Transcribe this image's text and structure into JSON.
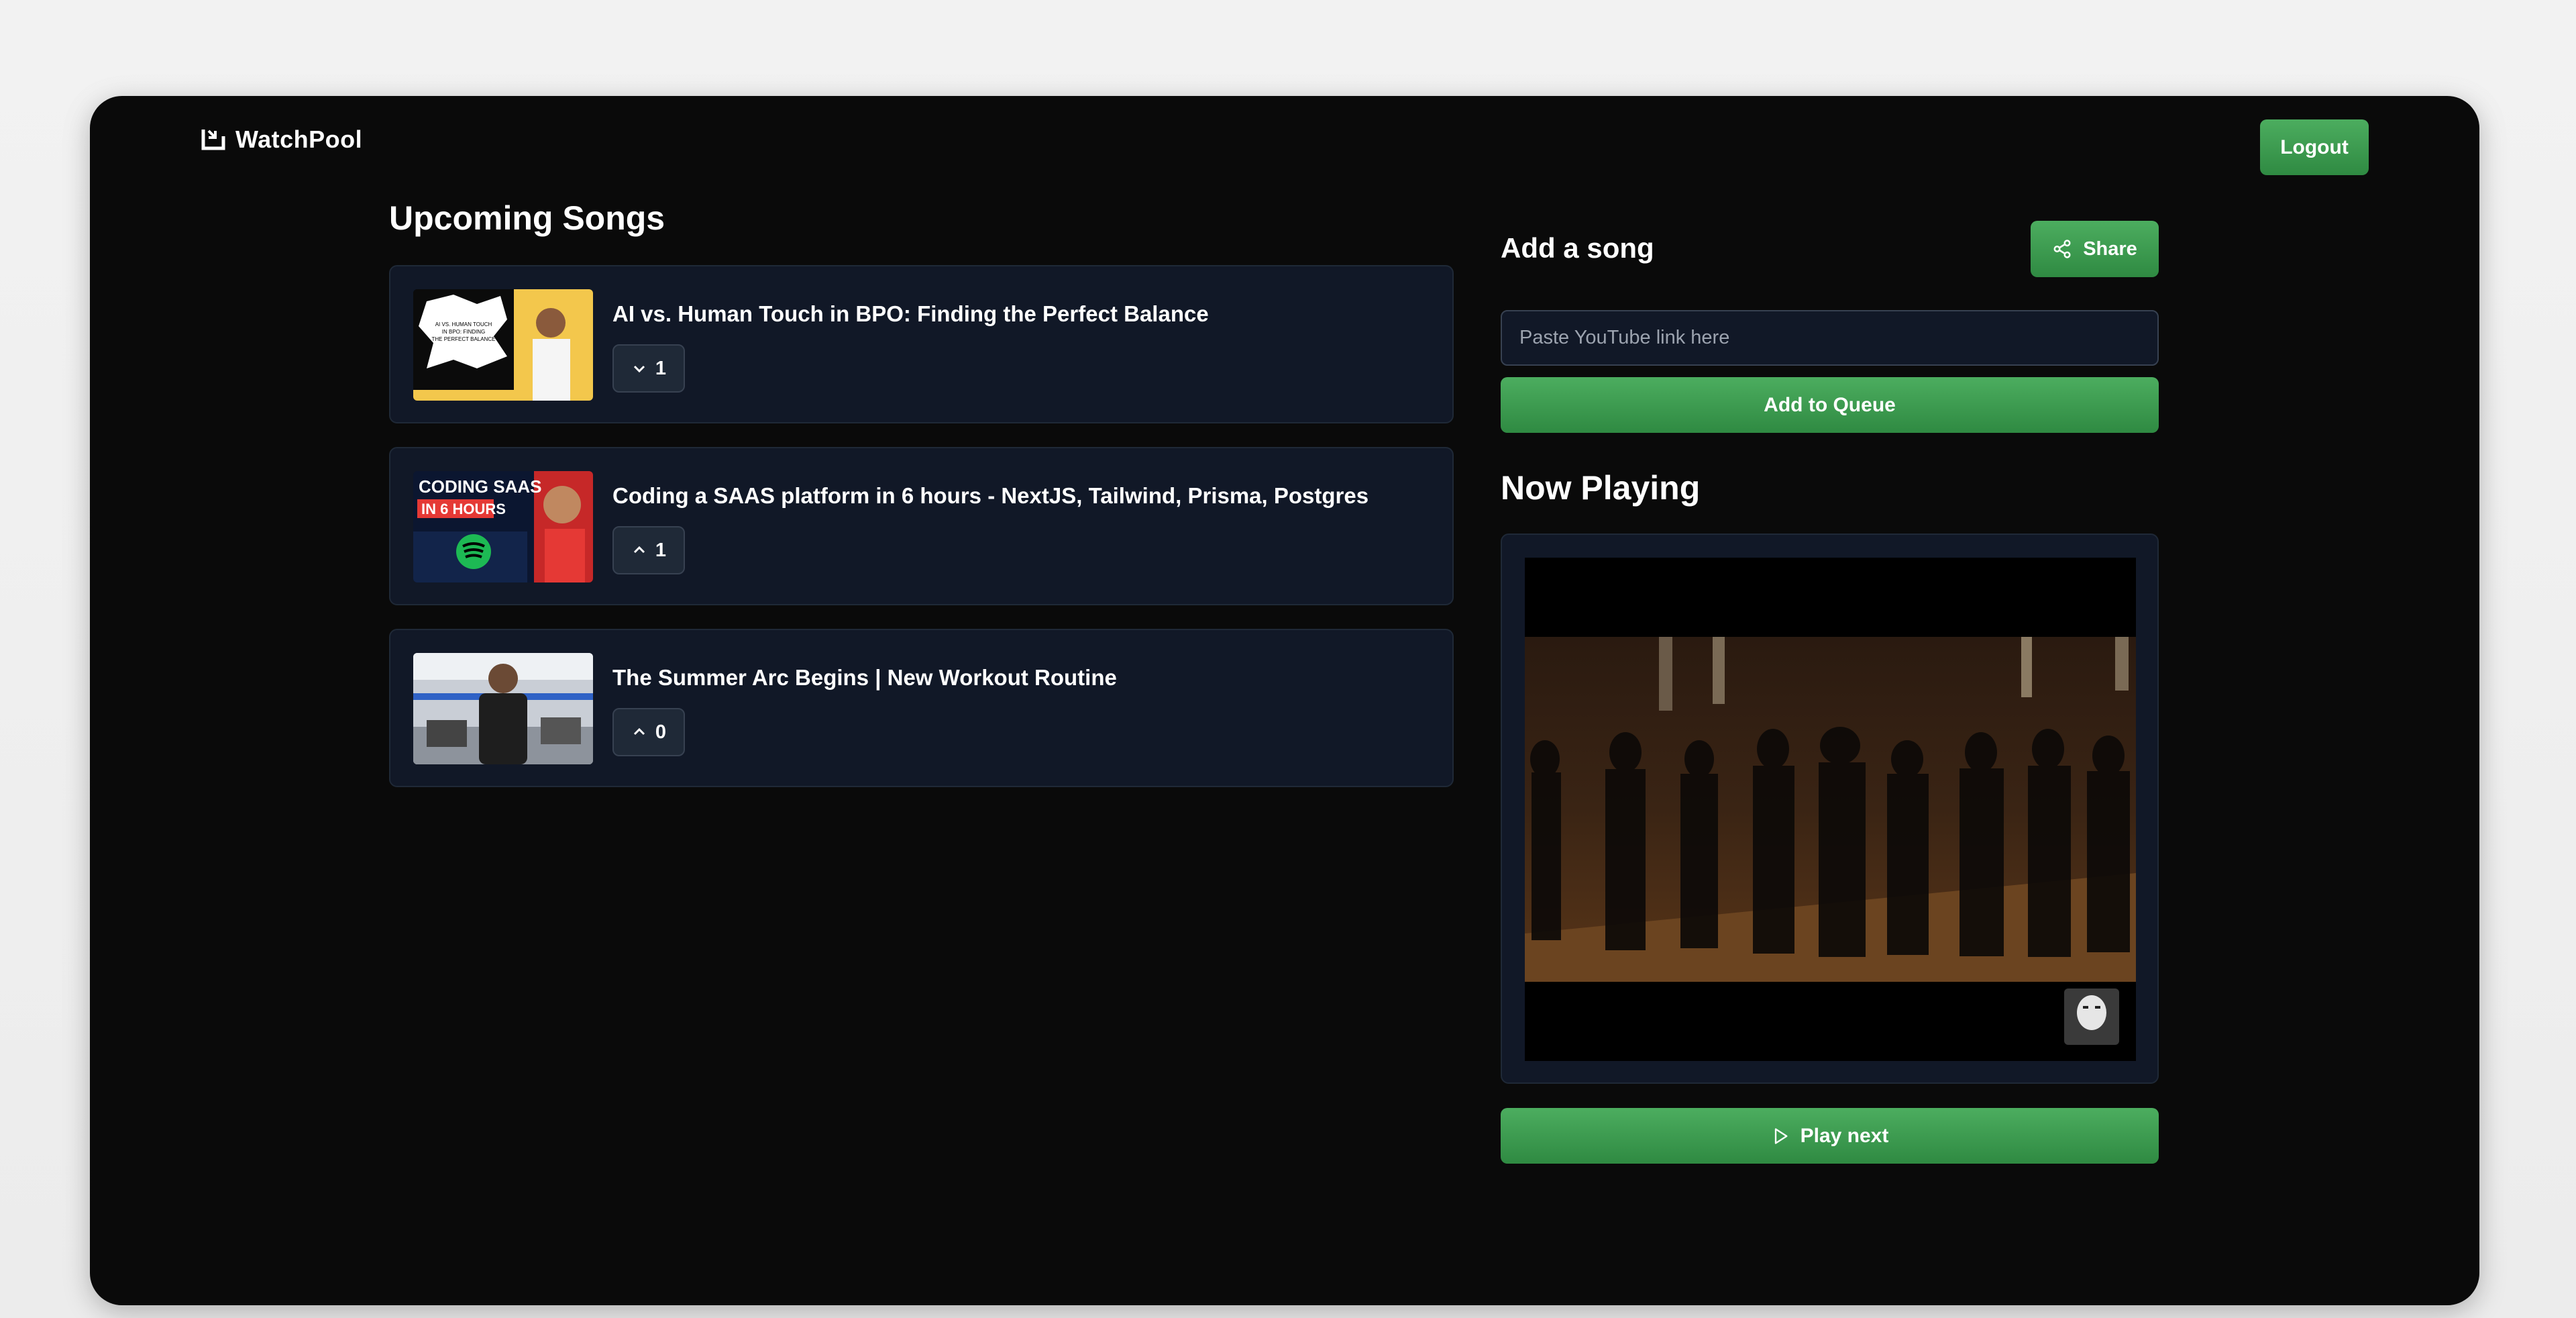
{
  "app": {
    "name": "WatchPool"
  },
  "header": {
    "logout_label": "Logout"
  },
  "upcoming": {
    "title": "Upcoming Songs",
    "songs": [
      {
        "title": "AI vs. Human Touch in BPO: Finding the Perfect Balance",
        "votes": "1",
        "vote_icon": "chevron-down-icon",
        "thumb_text": "AI VS. HUMAN TOUCH IN BPO: FINDING THE PERFECT BALANCE"
      },
      {
        "title": "Coding a SAAS platform in 6 hours - NextJS, Tailwind, Prisma, Postgres",
        "votes": "1",
        "vote_icon": "chevron-up-icon",
        "thumb_text_1": "CODING SAAS",
        "thumb_text_2": "IN 6 HOURS"
      },
      {
        "title": "The Summer Arc Begins | New Workout Routine",
        "votes": "0",
        "vote_icon": "chevron-up-icon"
      }
    ]
  },
  "add_song": {
    "title": "Add a song",
    "share_label": "Share",
    "input_placeholder": "Paste YouTube link here",
    "add_label": "Add to Queue"
  },
  "now_playing": {
    "title": "Now Playing",
    "play_next_label": "Play next"
  },
  "colors": {
    "accent": "#3f9d52",
    "card_bg": "#111827",
    "window_bg": "#0a0a0a"
  }
}
